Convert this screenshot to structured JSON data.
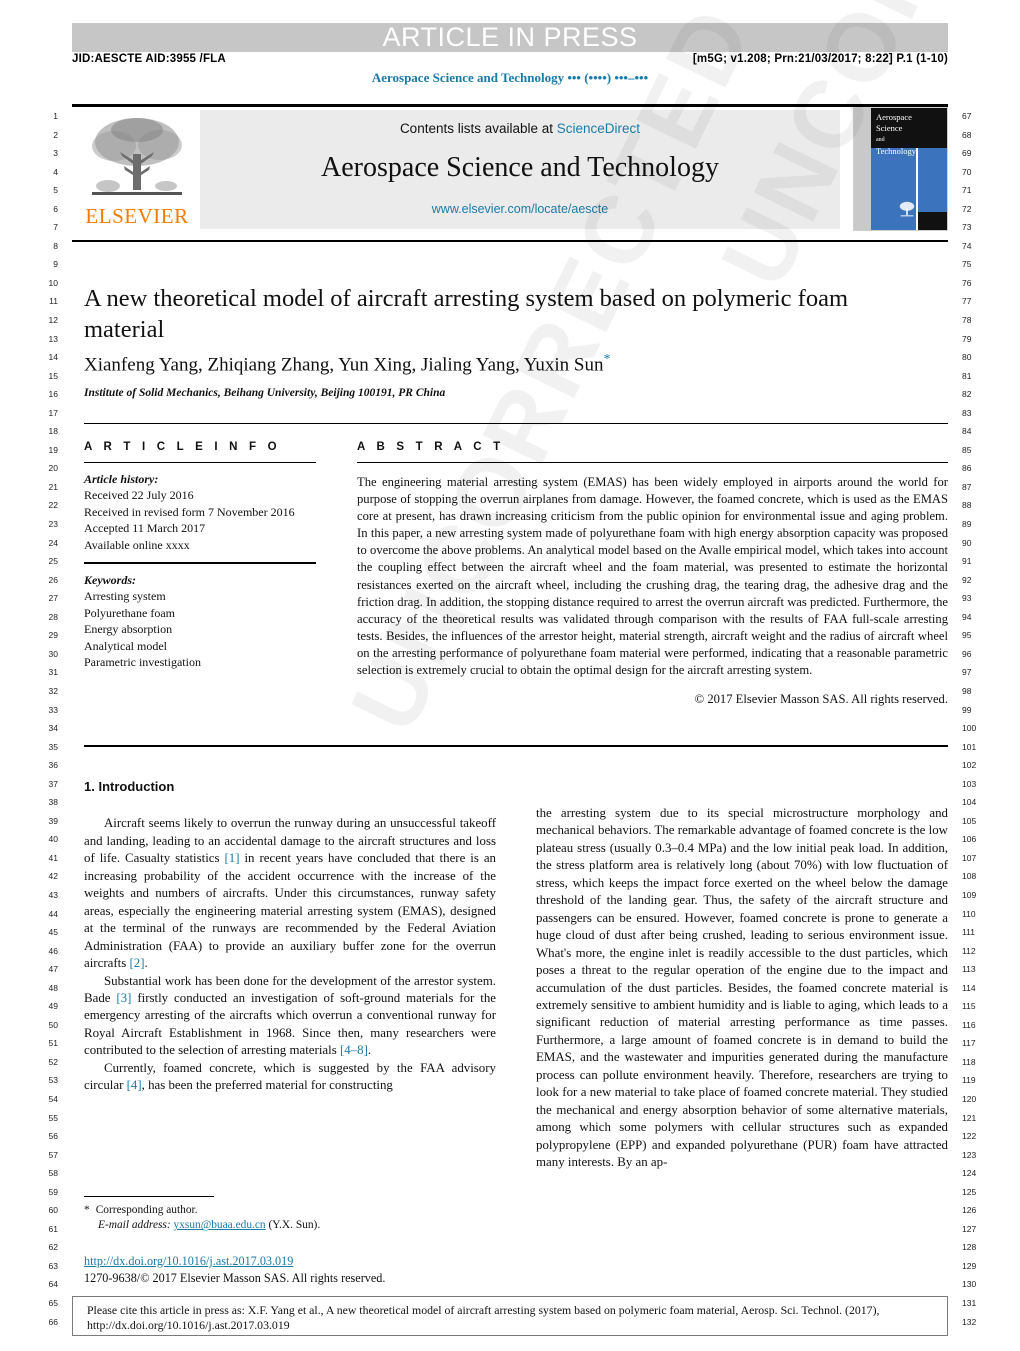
{
  "header": {
    "banner_text": "ARTICLE IN PRESS",
    "jid_line": "JID:AESCTE    AID:3955 /FLA",
    "prn_line": "[m5G; v1.208; Prn:21/03/2017; 8:22] P.1 (1-10)",
    "running_journal": "Aerospace Science and Technology ••• (••••) •••–•••"
  },
  "masthead": {
    "contents_prefix": "Contents lists available at ",
    "sciencedirect": "ScienceDirect",
    "journal_title": "Aerospace Science and Technology",
    "journal_url": "www.elsevier.com/locate/aescte",
    "publisher_logo_text": "ELSEVIER",
    "cover_title_line1": "Aerospace",
    "cover_title_line2": "Science",
    "cover_title_line3": "and",
    "cover_title_line4": "Technology"
  },
  "article": {
    "title": "A new theoretical model of aircraft arresting system based on polymeric foam material",
    "authors": "Xianfeng Yang, Zhiqiang Zhang, Yun Xing, Jialing Yang, Yuxin Sun",
    "corresponding_marker": "*",
    "affiliation": "Institute of Solid Mechanics, Beihang University, Beijing 100191, PR China"
  },
  "info": {
    "heading": "A R T I C L E   I N F O",
    "history_label": "Article history:",
    "history": [
      "Received 22 July 2016",
      "Received in revised form 7 November 2016",
      "Accepted 11 March 2017",
      "Available online xxxx"
    ],
    "keywords_label": "Keywords:",
    "keywords": [
      "Arresting system",
      "Polyurethane foam",
      "Energy absorption",
      "Analytical model",
      "Parametric investigation"
    ]
  },
  "abstract": {
    "heading": "A B S T R A C T",
    "text": "The engineering material arresting system (EMAS) has been widely employed in airports around the world for purpose of stopping the overrun airplanes from damage. However, the foamed concrete, which is used as the EMAS core at present, has drawn increasing criticism from the public opinion for environmental issue and aging problem. In this paper, a new arresting system made of polyurethane foam with high energy absorption capacity was proposed to overcome the above problems. An analytical model based on the Avalle empirical model, which takes into account the coupling effect between the aircraft wheel and the foam material, was presented to estimate the horizontal resistances exerted on the aircraft wheel, including the crushing drag, the tearing drag, the adhesive drag and the friction drag. In addition, the stopping distance required to arrest the overrun aircraft was predicted. Furthermore, the accuracy of the theoretical results was validated through comparison with the results of FAA full-scale arresting tests. Besides, the influences of the arrestor height, material strength, aircraft weight and the radius of aircraft wheel on the arresting performance of polyurethane foam material were performed, indicating that a reasonable parametric selection is extremely crucial to obtain the optimal design for the aircraft arresting system.",
    "copyright": "© 2017 Elsevier Masson SAS. All rights reserved."
  },
  "body": {
    "section_heading": "1. Introduction",
    "left_paragraph_1_a": "Aircraft seems likely to overrun the runway during an unsuccessful takeoff and landing, leading to an accidental damage to the aircraft structures and loss of life. Casualty statistics ",
    "ref1": "[1]",
    "left_paragraph_1_b": " in recent years have concluded that there is an increasing probability of the accident occurrence with the increase of the weights and numbers of aircrafts. Under this circumstances, runway safety areas, especially the engineering material arresting system (EMAS), designed at the terminal of the runways are recommended by the Federal Aviation Administration (FAA) to provide an auxiliary buffer zone for the overrun aircrafts ",
    "ref2": "[2]",
    "left_paragraph_1_c": ".",
    "left_paragraph_2_a": "Substantial work has been done for the development of the arrestor system. Bade ",
    "ref3": "[3]",
    "left_paragraph_2_b": " firstly conducted an investigation of soft-ground materials for the emergency arresting of the aircrafts which overrun a conventional runway for Royal Aircraft Establishment in 1968. Since then, many researchers were contributed to the selection of arresting materials ",
    "ref48": "[4–8]",
    "left_paragraph_2_c": ".",
    "left_paragraph_3_a": "Currently, foamed concrete, which is suggested by the FAA advisory circular ",
    "ref4": "[4]",
    "left_paragraph_3_b": ", has been the preferred material for constructing",
    "right_paragraph": "the arresting system due to its special microstructure morphology and mechanical behaviors. The remarkable advantage of foamed concrete is the low plateau stress (usually 0.3–0.4 MPa) and the low initial peak load. In addition, the stress platform area is relatively long (about 70%) with low fluctuation of stress, which keeps the impact force exerted on the wheel below the damage threshold of the landing gear. Thus, the safety of the aircraft structure and passengers can be ensured. However, foamed concrete is prone to generate a huge cloud of dust after being crushed, leading to serious environment issue. What's more, the engine inlet is readily accessible to the dust particles, which poses a threat to the regular operation of the engine due to the impact and accumulation of the dust particles. Besides, the foamed concrete material is extremely sensitive to ambient humidity and is liable to aging, which leads to a significant reduction of material arresting performance as time passes. Furthermore, a large amount of foamed concrete is in demand to build the EMAS, and the wastewater and impurities generated during the manufacture process can pollute environment heavily. Therefore, researchers are trying to look for a new material to take place of foamed concrete material. They studied the mechanical and energy absorption behavior of some alternative materials, among which some polymers with cellular structures such as expanded polypropylene (EPP) and expanded polyurethane (PUR) foam have attracted many interests. By an ap-"
  },
  "footnotes": {
    "corresponding_marker": "*",
    "corresponding_text": "Corresponding author.",
    "email_label": "E-mail address:",
    "email": "yxsun@buaa.edu.cn",
    "email_owner": "(Y.X. Sun)."
  },
  "doi": {
    "link": "http://dx.doi.org/10.1016/j.ast.2017.03.019",
    "issn_line": "1270-9638/© 2017 Elsevier Masson SAS. All rights reserved."
  },
  "citebox": {
    "line1": "Please cite this article in press as: X.F. Yang et al., A new theoretical model of aircraft arresting system based on polymeric foam material, Aerosp. Sci. Technol. (2017),",
    "line2": "http://dx.doi.org/10.1016/j.ast.2017.03.019"
  },
  "watermark": {
    "text1": "UNCORRECTED PROOF",
    "text2": "UNCORRECTED PROOF"
  },
  "line_numbers": {
    "left_start": 1,
    "left_end": 66,
    "right_start": 67,
    "right_end": 132
  }
}
